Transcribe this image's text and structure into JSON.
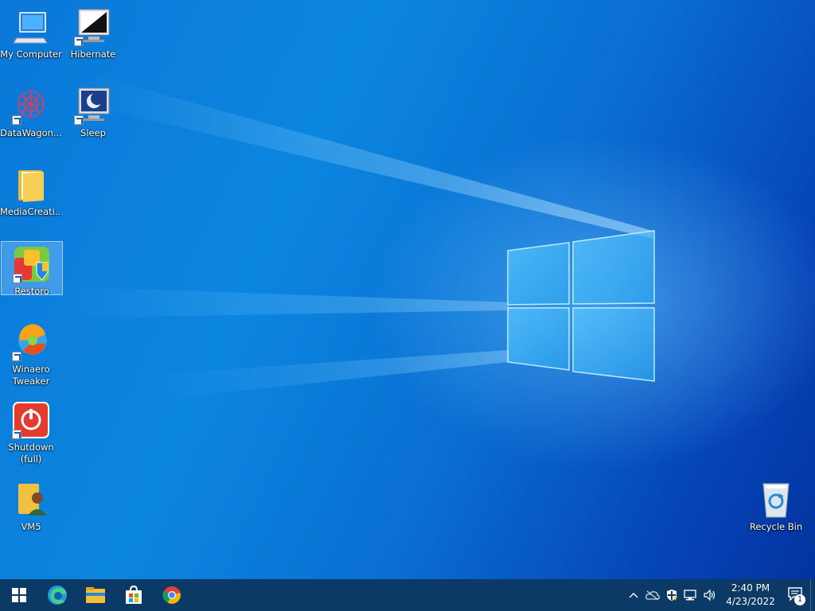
{
  "desktop": {
    "icons": [
      {
        "label": "My Computer",
        "icon": "computer-icon"
      },
      {
        "label": "Hibernate",
        "icon": "hibernate-icon"
      },
      {
        "label": "DataWagon...",
        "icon": "datawagon-icon"
      },
      {
        "label": "Sleep",
        "icon": "sleep-icon"
      },
      {
        "label": "MediaCreati...",
        "icon": "folder-icon"
      },
      {
        "label": "Restoro",
        "icon": "restoro-icon",
        "selected": true
      },
      {
        "label": "Winaero\nTweaker",
        "icon": "winaero-icon"
      },
      {
        "label": "Shutdown\n(full)",
        "icon": "shutdown-icon"
      },
      {
        "label": "VM5",
        "icon": "user-folder-icon"
      },
      {
        "label": "Recycle Bin",
        "icon": "recycle-bin-icon"
      }
    ]
  },
  "taskbar": {
    "pinned": [
      "start-icon",
      "edge-icon",
      "file-explorer-icon",
      "store-icon",
      "chrome-icon"
    ],
    "tray": {
      "icons": [
        "chevron-up-icon",
        "onedrive-icon",
        "security-icon",
        "network-icon",
        "volume-icon"
      ],
      "time": "2:40 PM",
      "date": "4/23/2022",
      "notification_count": "1"
    }
  },
  "colors": {
    "taskbar": "#0c3a66",
    "desktop_accent": "#0a78d8",
    "selection": "#aad2ff"
  }
}
